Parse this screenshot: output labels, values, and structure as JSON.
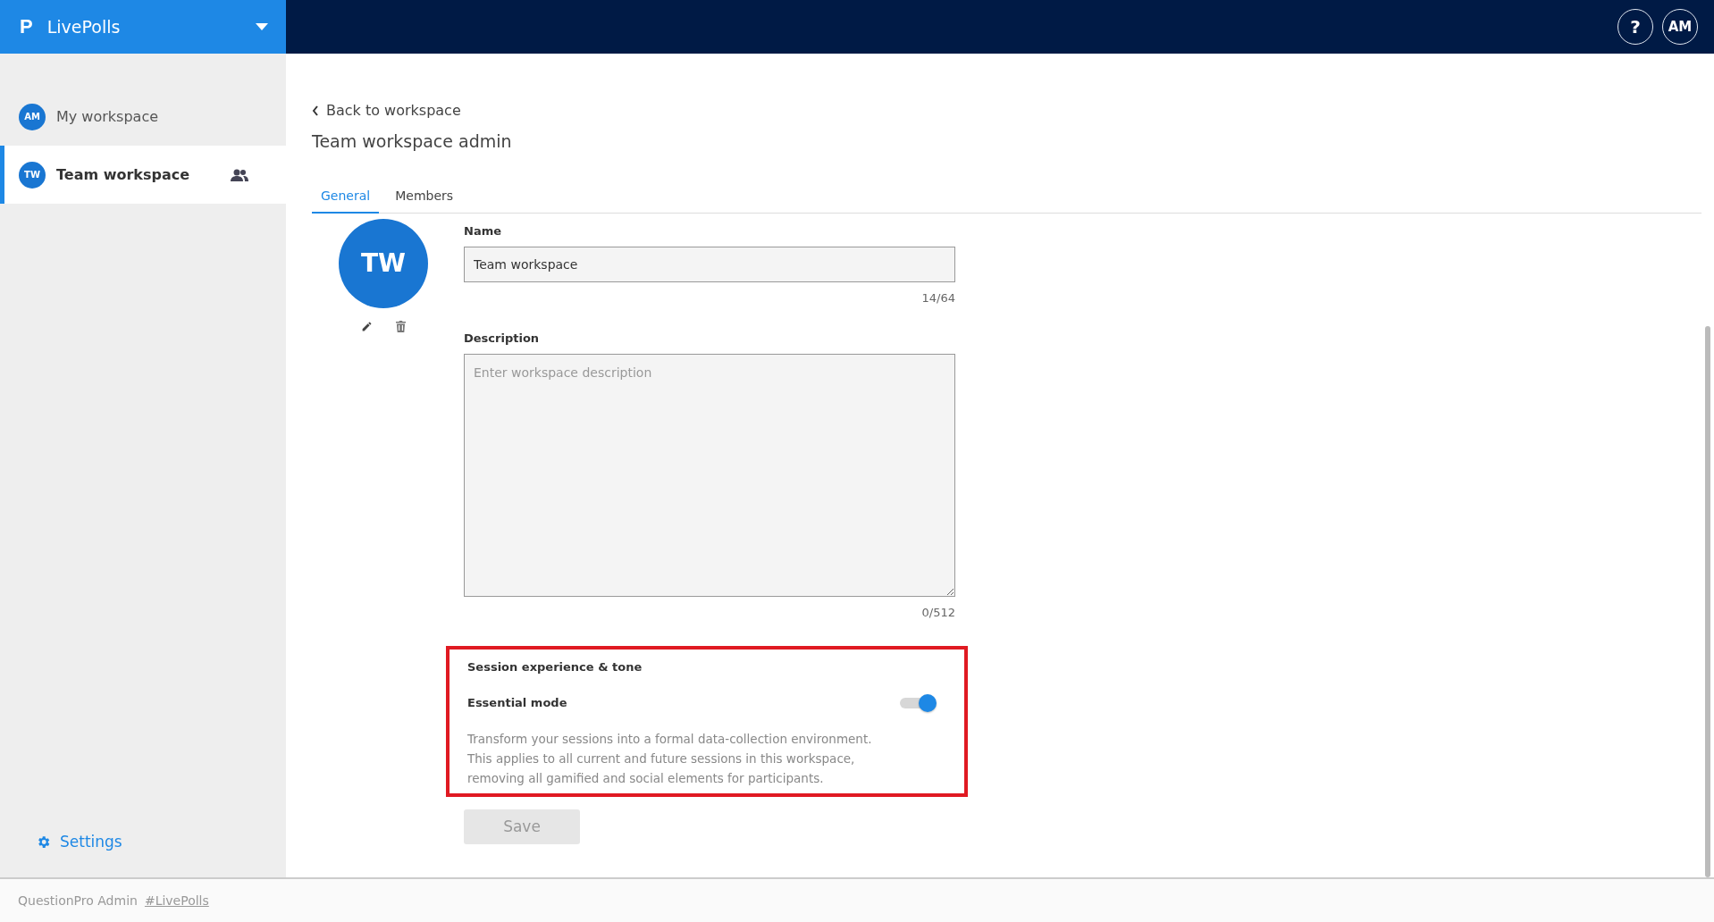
{
  "brand": {
    "name": "LivePolls",
    "logo": "P"
  },
  "header_buttons": [
    {
      "kind": "help",
      "label": "?"
    },
    {
      "kind": "avatar",
      "label": "AM"
    }
  ],
  "sidebar": {
    "items": [
      {
        "initials": "AM",
        "label": "My workspace",
        "selected": false,
        "team": false
      },
      {
        "initials": "TW",
        "label": "Team workspace",
        "selected": true,
        "team": true
      }
    ],
    "settings": "Settings"
  },
  "back_link": "Back to workspace",
  "page_title": "Team workspace admin",
  "tabs": [
    {
      "label": "General",
      "selected": true
    },
    {
      "label": "Members",
      "selected": false
    }
  ],
  "workspace_avatar": "TW",
  "name_field": {
    "label": "Name",
    "value": "Team workspace",
    "counter": "14/64"
  },
  "description_field": {
    "label": "Description",
    "placeholder": "Enter workspace description",
    "counter": "0/512"
  },
  "session_section": {
    "title": "Session experience & tone",
    "highlighted": true,
    "toggle": {
      "label": "Essential mode",
      "on": true
    },
    "description_lines": [
      "Transform your sessions into a formal data-collection environment.",
      "This applies to all current and future sessions in this workspace,",
      "removing all gamified and social elements for participants."
    ]
  },
  "save_button": {
    "label": "Save",
    "disabled": true
  },
  "footer": {
    "text": "QuestionPro Admin",
    "link": "#LivePolls"
  }
}
